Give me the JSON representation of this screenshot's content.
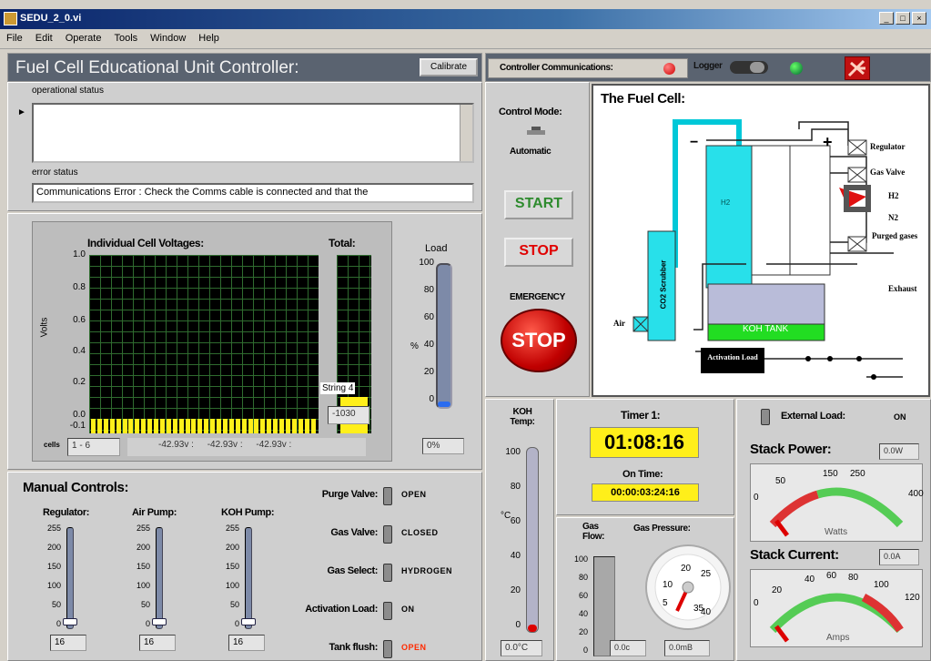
{
  "window": {
    "title": "SEDU_2_0.vi",
    "buttons": [
      "_",
      "□",
      "×"
    ]
  },
  "menu": [
    "File",
    "Edit",
    "Operate",
    "Tools",
    "Window",
    "Help"
  ],
  "header": {
    "title": "Fuel Cell Educational Unit Controller:",
    "calibrate": "Calibrate"
  },
  "status": {
    "operational_label": "operational status",
    "operational_value": "",
    "error_label": "error status",
    "error_value": "Communications Error : Check the Comms cable is connected and that the"
  },
  "voltages": {
    "title": "Individual Cell Voltages:",
    "total_label": "Total:",
    "ylabel": "Volts",
    "yticks": [
      "1.0",
      "0.8",
      "0.6",
      "0.4",
      "0.2",
      "0.0",
      "-0.1"
    ],
    "string_label": "String 4",
    "total_value": "-1030",
    "cells_label": "cells",
    "cells_range": "1 - 6",
    "cell_values": [
      "-42.93v :",
      "-42.93v :",
      "-42.93v :"
    ]
  },
  "load": {
    "label": "Load",
    "unit": "%",
    "ticks": [
      "100",
      "80",
      "60",
      "40",
      "20",
      "0"
    ],
    "value": "0%",
    "level": 0.02
  },
  "manual": {
    "title": "Manual Controls:",
    "sliders": [
      {
        "name": "Regulator:",
        "ticks": [
          "255",
          "200",
          "150",
          "100",
          "50",
          "0"
        ],
        "value": "16"
      },
      {
        "name": "Air Pump:",
        "ticks": [
          "255",
          "200",
          "150",
          "100",
          "50",
          "0"
        ],
        "value": "16"
      },
      {
        "name": "KOH Pump:",
        "ticks": [
          "255",
          "200",
          "150",
          "100",
          "50",
          "0"
        ],
        "value": "16"
      }
    ],
    "switches": [
      {
        "name": "Purge Valve:",
        "state": "OPEN",
        "color": "#000000"
      },
      {
        "name": "Gas Valve:",
        "state": "CLOSED",
        "color": "#000000"
      },
      {
        "name": "Gas Select:",
        "state": "HYDROGEN",
        "color": "#000000"
      },
      {
        "name": "Activation Load:",
        "state": "ON",
        "color": "#000000"
      },
      {
        "name": "Tank flush:",
        "state": "OPEN",
        "color": "#ff2a00"
      }
    ]
  },
  "comms": {
    "label": "Controller Communications:",
    "logger": "Logger"
  },
  "control": {
    "mode_label": "Control Mode:",
    "mode_value": "Automatic",
    "start": "START",
    "stop": "STOP",
    "emergency_label": "EMERGENCY",
    "emergency_stop": "STOP"
  },
  "diagram": {
    "title": "The Fuel Cell:",
    "labels": {
      "regulator": "Regulator",
      "gas_valve": "Gas Valve",
      "h2": "H2",
      "n2": "N2",
      "purged": "Purged gases",
      "exhaust": "Exhaust",
      "air": "Air",
      "scrubber": "CO2 Scrubber",
      "koh_tank": "KOH TANK",
      "activation": "Activation Load",
      "minus": "−",
      "plus": "+",
      "cell": "H2"
    }
  },
  "koh": {
    "label": "KOH Temp:",
    "unit": "°C",
    "ticks": [
      "100",
      "80",
      "60",
      "40",
      "20",
      "0"
    ],
    "value": "0.0°C"
  },
  "timer": {
    "label": "Timer 1:",
    "value": "01:08:16",
    "on_time_label": "On Time:",
    "on_time_value": "00:00:03:24:16"
  },
  "gas": {
    "flow_label": "Gas Flow:",
    "flow_ticks": [
      "100",
      "80",
      "60",
      "40",
      "20",
      "0"
    ],
    "flow_value": "0.0c",
    "pressure_label": "Gas Pressure:",
    "pressure_ticks": [
      "5",
      "10",
      "20",
      "25",
      "35",
      "40"
    ],
    "pressure_value": "0.0mB"
  },
  "power": {
    "ext_label": "External Load:",
    "ext_state": "ON",
    "stack_power_label": "Stack Power:",
    "stack_power_value": "0.0W",
    "power_ticks": [
      "0",
      "50",
      "150",
      "250",
      "400"
    ],
    "power_unit": "Watts",
    "stack_current_label": "Stack Current:",
    "stack_current_value": "0.0A",
    "current_ticks": [
      "0",
      "20",
      "40",
      "60",
      "80",
      "100",
      "120"
    ],
    "current_unit": "Amps"
  }
}
